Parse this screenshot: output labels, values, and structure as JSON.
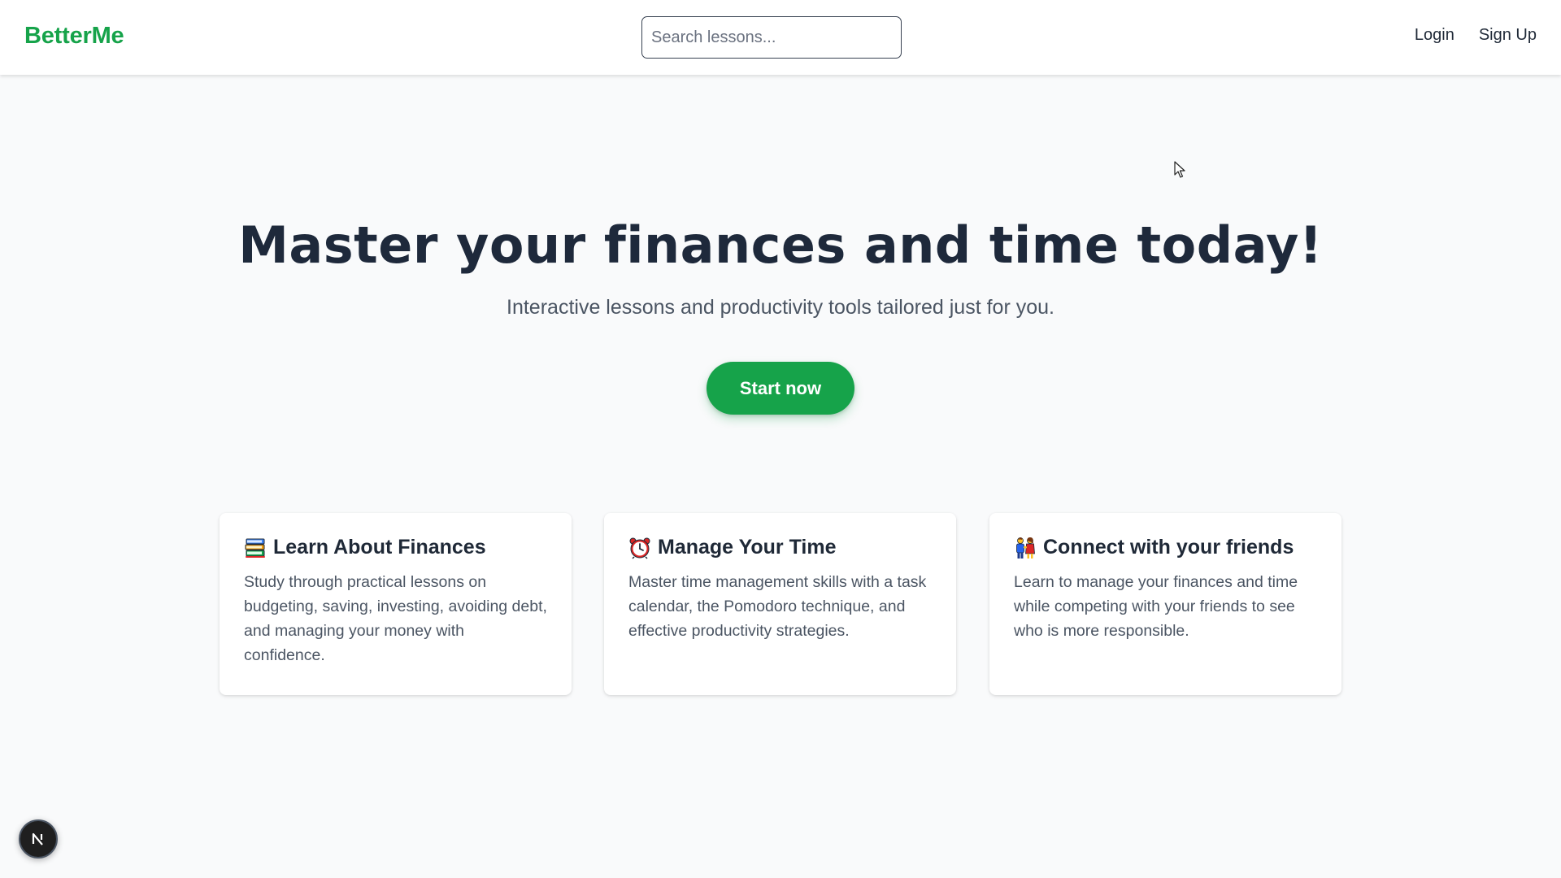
{
  "header": {
    "logo": "BetterMe",
    "search_placeholder": "Search lessons...",
    "login_label": "Login",
    "signup_label": "Sign Up"
  },
  "hero": {
    "title": "Master your finances and time today!",
    "subtitle": "Interactive lessons and productivity tools tailored just for you.",
    "cta_label": "Start now"
  },
  "features": [
    {
      "icon": "books-icon",
      "title": "Learn About Finances",
      "description": "Study through practical lessons on budgeting, saving, investing, avoiding debt, and managing your money with confidence."
    },
    {
      "icon": "alarm-clock-icon",
      "title": "Manage Your Time",
      "description": "Master time management skills with a task calendar, the Pomodoro technique, and effective productivity strategies."
    },
    {
      "icon": "friends-icon",
      "title": "Connect with your friends",
      "description": "Learn to manage your finances and time while competing with your friends to see who is more responsible."
    }
  ],
  "dev_badge": {
    "letter": "N"
  },
  "colors": {
    "brand_green": "#16a34a",
    "background": "#f9fafb",
    "heading": "#1e293b",
    "body_text": "#4b5563"
  }
}
